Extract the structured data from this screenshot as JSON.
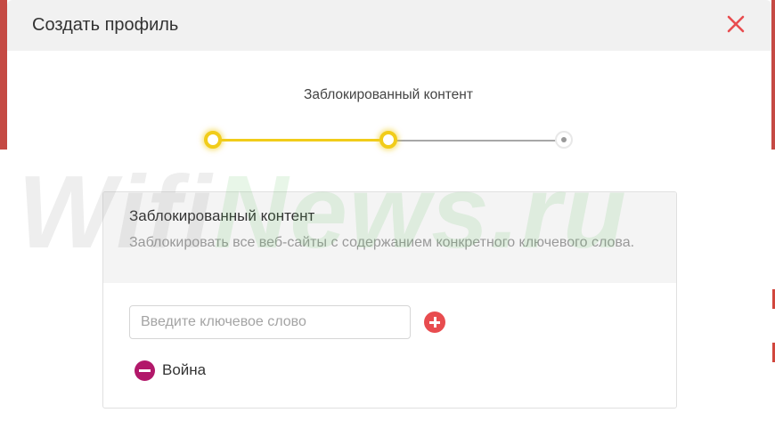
{
  "modal": {
    "title": "Создать профиль",
    "close_icon": "close-icon",
    "accent_color": "#e84c4f"
  },
  "stepper": {
    "current_label": "Заблокированный контент",
    "steps": [
      {
        "state": "completed"
      },
      {
        "state": "active"
      },
      {
        "state": "pending"
      }
    ],
    "active_color": "#f1cc1a"
  },
  "blocked_content": {
    "title": "Заблокированный контент",
    "description": "Заблокировать все веб-сайты с содержанием конкретного ключевого слова.",
    "input_placeholder": "Введите ключевое слово",
    "input_value": "",
    "add_icon": "plus-circle-icon",
    "keywords": [
      {
        "text": "Война",
        "remove_icon": "minus-circle-icon"
      }
    ]
  },
  "watermark": {
    "part1": "Wifi",
    "part2": "News.ru"
  }
}
